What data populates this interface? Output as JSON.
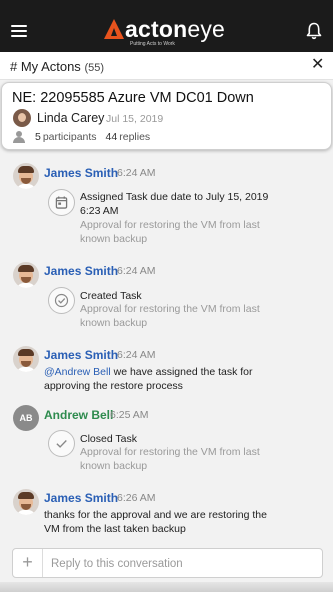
{
  "header": {
    "logo_bold": "acton",
    "logo_light": "eye",
    "logo_tagline": "Putting Acts to Work",
    "menu_icon": "hamburger-menu-icon",
    "bell_icon": "bell-icon",
    "brand_color": "#e8531d"
  },
  "actons": {
    "title": "# My Actons",
    "count": "(55)",
    "close_icon": "close-icon",
    "close_glyph": "✕"
  },
  "card": {
    "title": "NE: 22095585 Azure VM DC01 Down",
    "author": "Linda Carey",
    "date": "Jul 15, 2019",
    "participants_count": "5",
    "participants_label": "participants",
    "replies_count": "44",
    "replies_label": "replies"
  },
  "messages": [
    {
      "sender": "James Smith",
      "time": "6:24 AM",
      "icon": "calendar-icon",
      "title": "Assigned Task due date to July 15, 2019 6:23 AM",
      "subtitle": "Approval for restoring the VM from last known backup"
    },
    {
      "sender": "James Smith",
      "time": "6:24 AM",
      "icon": "check-circle-icon",
      "title": "Created Task",
      "subtitle": "Approval for restoring the VM from last known backup"
    },
    {
      "sender": "James Smith",
      "time": "6:24 AM",
      "mention": "@Andrew  Bell",
      "text": " we have assigned the task for approving the restore process"
    },
    {
      "sender": "Andrew Bell",
      "initials": "AB",
      "time": "6:25 AM",
      "icon": "check-icon",
      "title": "Closed Task",
      "subtitle": "Approval for restoring the VM from last known backup"
    },
    {
      "sender": "James Smith",
      "time": "6:26 AM",
      "text": "thanks for the approval and we are restoring the VM from the last taken backup"
    }
  ],
  "reply": {
    "plus": "+",
    "placeholder": "Reply to this conversation"
  }
}
